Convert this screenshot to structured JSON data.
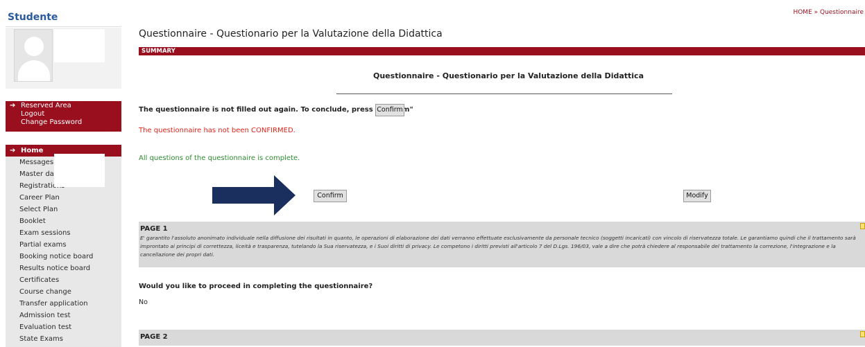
{
  "sidebar": {
    "title": "Studente",
    "account_links": [
      "Reserved Area",
      "Logout",
      "Change Password"
    ],
    "home_label": "Home",
    "menu_items": [
      "Messages",
      "Master data",
      "Registrations",
      "Career Plan",
      "Select Plan",
      "Booklet",
      "Exam sessions",
      "Partial exams",
      "Booking notice board",
      "Results notice board",
      "Certificates",
      "Course change",
      "Transfer application",
      "Admission test",
      "Evaluation test",
      "State Exams"
    ]
  },
  "breadcrumb": "HOME » Questionnaire",
  "main": {
    "page_title": "Questionnaire - Questionario per la Valutazione della Didattica",
    "summary_label": "SUMMARY",
    "center_title": "Questionnaire - Questionario per la Valutazione della Didattica",
    "not_filled_text": "The questionnaire is not filled out again. To conclude, press \"Confirm\"",
    "inline_confirm_label": "Confirm",
    "not_confirmed_text": "The questionnaire has not been CONFIRMED.",
    "complete_text": "All questions of the questionnaire is complete.",
    "confirm_label": "Confirm",
    "modify_label": "Modify",
    "page1_title": "PAGE 1",
    "page1_text": "E' garantito l'assoluto anonimato individuale nella diffusione dei risultati in quanto, le operazioni di elaborazione dei dati verranno effettuate esclusivamente da personale tecnico (soggetti incaricati) con vincolo di riservatezza totale. Le garantiamo quindi che il trattamento sarà improntato ai principi di correttezza, liceità e trasparenza, tutelando la Sua riservatezza, e i Suoi diritti di privacy. Le competono i diritti previsti all'articolo 7 del D.Lgs. 196/03, vale a dire che potrà chiedere al responsabile del trattamento la correzione, l'integrazione e la cancellazione dei propri dati.",
    "question": "Would you like to proceed in completing the questionnaire?",
    "answer": "No",
    "page2_title": "PAGE 2"
  },
  "colors": {
    "accent": "#9a0f1e",
    "link_blue": "#2a5aa0",
    "error": "#e0241b",
    "success": "#2e8b2e",
    "arrow": "#1a2f5e"
  },
  "icons": [
    "user-avatar-icon",
    "arrow-right-icon",
    "note-icon"
  ]
}
